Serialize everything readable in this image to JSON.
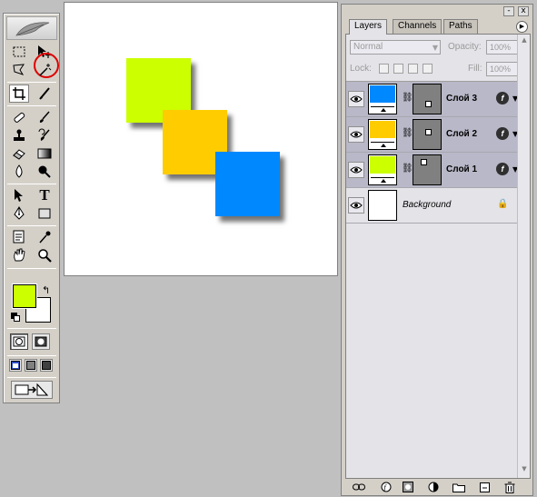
{
  "canvas": {
    "squares": [
      {
        "name": "yellow-green-square",
        "color": "#ccff00"
      },
      {
        "name": "orange-square",
        "color": "#ffcc00"
      },
      {
        "name": "blue-square",
        "color": "#0088ff"
      }
    ]
  },
  "toolbox": {
    "foreground_color": "#ccff00",
    "background_color": "#ffffff",
    "type_tool_glyph": "T",
    "swap_glyph": "↰"
  },
  "layers_panel": {
    "tabs": [
      {
        "label": "Layers",
        "active": true
      },
      {
        "label": "Channels",
        "active": false
      },
      {
        "label": "Paths",
        "active": false
      }
    ],
    "window_buttons": {
      "minimize": "-",
      "close": "x"
    },
    "blend_mode": "Normal",
    "opacity_label": "Opacity:",
    "opacity_value": "100%",
    "lock_label": "Lock:",
    "fill_label": "Fill:",
    "fill_value": "100%",
    "layers": [
      {
        "name": "Слой 3",
        "color": "#0088ff",
        "selected": true
      },
      {
        "name": "Слой 2",
        "color": "#ffcc00",
        "selected": true
      },
      {
        "name": "Слой 1",
        "color": "#ccff00",
        "selected": true
      },
      {
        "name": "Background",
        "color": "#ffffff",
        "selected": false
      }
    ],
    "fx_label": "f",
    "accent_colors": {
      "selected_row": "#b8b8c8",
      "highlight_circle": "#e00000"
    }
  }
}
